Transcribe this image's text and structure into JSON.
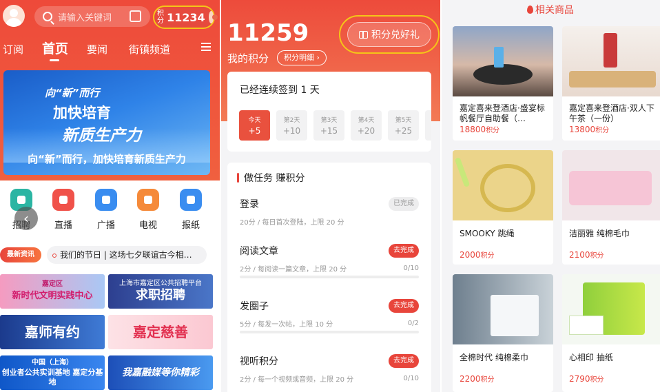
{
  "left": {
    "search_placeholder": "请输入关键词",
    "points_label": "积分",
    "points_value": "11234",
    "tabs": [
      {
        "label": "订阅"
      },
      {
        "label": "首页"
      },
      {
        "label": "要闻"
      },
      {
        "label": "街镇频道"
      }
    ],
    "banner": {
      "line1": "向“新”而行",
      "line2": "加快培育",
      "line3": "新质生产力",
      "line4": "向“新”而行，加快培育新质生产力"
    },
    "quick_icons": [
      {
        "label": "招聘",
        "color": "#2bb5a3"
      },
      {
        "label": "直播",
        "color": "#f0524a"
      },
      {
        "label": "广播",
        "color": "#3a8df0"
      },
      {
        "label": "电视",
        "color": "#f58a3a"
      },
      {
        "label": "报纸",
        "color": "#3a8df0"
      }
    ],
    "news_tag": "最新资讯",
    "news_text": "我们的节日 | 这场七夕联谊古今相…",
    "tiles": [
      {
        "small": "嘉定区",
        "big": "新时代文明实践中心"
      },
      {
        "small": "上海市嘉定区公共招聘平台",
        "big": "求职招聘"
      },
      {
        "small": "",
        "big": "嘉师有约"
      },
      {
        "small": "",
        "big": "嘉定慈善"
      },
      {
        "small": "中国（上海）",
        "big": "创业者公共实训基地 嘉定分基地"
      },
      {
        "small": "",
        "big": "我嘉融媒等你精彩"
      }
    ]
  },
  "middle": {
    "points_total": "11259",
    "my_points_label": "我的积分",
    "detail_link": "积分明细 ›",
    "redeem_button": "积分兑好礼",
    "checkin_title": "已经连续签到 1 天",
    "days": [
      {
        "day": "今天",
        "value": "+5"
      },
      {
        "day": "第2天",
        "value": "+10"
      },
      {
        "day": "第3天",
        "value": "+15"
      },
      {
        "day": "第4天",
        "value": "+20"
      },
      {
        "day": "第5天",
        "value": "+25"
      }
    ],
    "tasks_title": "做任务 赚积分",
    "tasks": [
      {
        "name": "登录",
        "desc": "20分 / 每日首次登陆，上限 20 分",
        "button": "已完成",
        "progress": ""
      },
      {
        "name": "阅读文章",
        "desc": "2分 / 每阅读一篇文章，上限 20 分",
        "button": "去完成",
        "progress": "0/10"
      },
      {
        "name": "发圈子",
        "desc": "5分 / 每发一次帖，上限 10 分",
        "button": "去完成",
        "progress": "0/2"
      },
      {
        "name": "视听积分",
        "desc": "2分 / 每一个视频或音频，上限 20 分",
        "button": "去完成",
        "progress": "0/10"
      }
    ]
  },
  "right": {
    "title": "相关商品",
    "products": [
      {
        "name": "嘉定喜来登酒店·盛宴标帆餐厅自助餐（…",
        "price": "18800",
        "unit": "积分"
      },
      {
        "name": "嘉定喜来登酒店·双人下午茶（一份）",
        "price": "13800",
        "unit": "积分"
      },
      {
        "name": "SMOOKY 跳绳",
        "price": "2000",
        "unit": "积分"
      },
      {
        "name": "洁丽雅 纯棉毛巾",
        "price": "2100",
        "unit": "积分"
      },
      {
        "name": "全棉时代 纯棉柔巾",
        "price": "2200",
        "unit": "积分"
      },
      {
        "name": "心相印 抽纸",
        "price": "2790",
        "unit": "积分"
      }
    ]
  }
}
